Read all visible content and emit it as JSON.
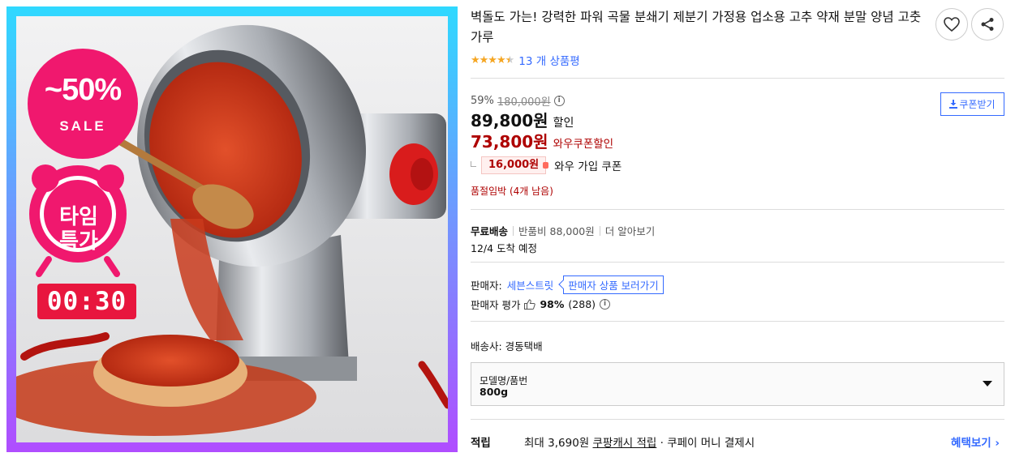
{
  "product": {
    "title": "벽돌도 가는! 강력한 파워 곡물 분쇄기 제분기 가정용 업소용 고추 약재 분말 양념 고춧가루",
    "rating_stars": 4.5,
    "review_count": "13 개 상품평",
    "image": {
      "sale_badge_pct": "~50%",
      "sale_badge_word": "SALE",
      "timer_label_line1": "타임",
      "timer_label_line2": "특가",
      "countdown": "00:30"
    }
  },
  "actions": {
    "wishlist_icon": "heart-icon",
    "share_icon": "share-icon"
  },
  "price": {
    "discount_rate": "59%",
    "original_price": "180,000원",
    "sale_price": "89,800원",
    "sale_label": "할인",
    "wow_price": "73,800원",
    "wow_label": "와우쿠폰할인",
    "coupon_amount": "16,000원",
    "coupon_label": "와우 가입 쿠폰",
    "coupon_button": "쿠폰받기",
    "stock_notice": "품절임박 (4개 남음)"
  },
  "shipping": {
    "free_label": "무료배송",
    "return_fee": "반품비 88,000원",
    "more_info": "더 알아보기",
    "arrival": "12/4 도착 예정"
  },
  "seller": {
    "label": "판매자:",
    "name": "세븐스트릿",
    "products_link": "판매자 상품 보러가기",
    "rating_label": "판매자 평가",
    "rating_pct": "98%",
    "rating_count": "(288)"
  },
  "delivery": {
    "carrier": "배송사:  경동택배"
  },
  "option": {
    "caption": "모델명/품번",
    "value": "800g"
  },
  "reward": {
    "label": "적립",
    "prefix": "최대 3,690원",
    "cash": "쿠팡캐시 적립",
    "suffix": "· 쿠페이 머니 결제시",
    "more": "혜택보기 ›"
  },
  "colors": {
    "accent_blue": "#346aff",
    "price_red": "#ae0000",
    "badge_pink": "#f0186e",
    "star": "#f5a623"
  }
}
